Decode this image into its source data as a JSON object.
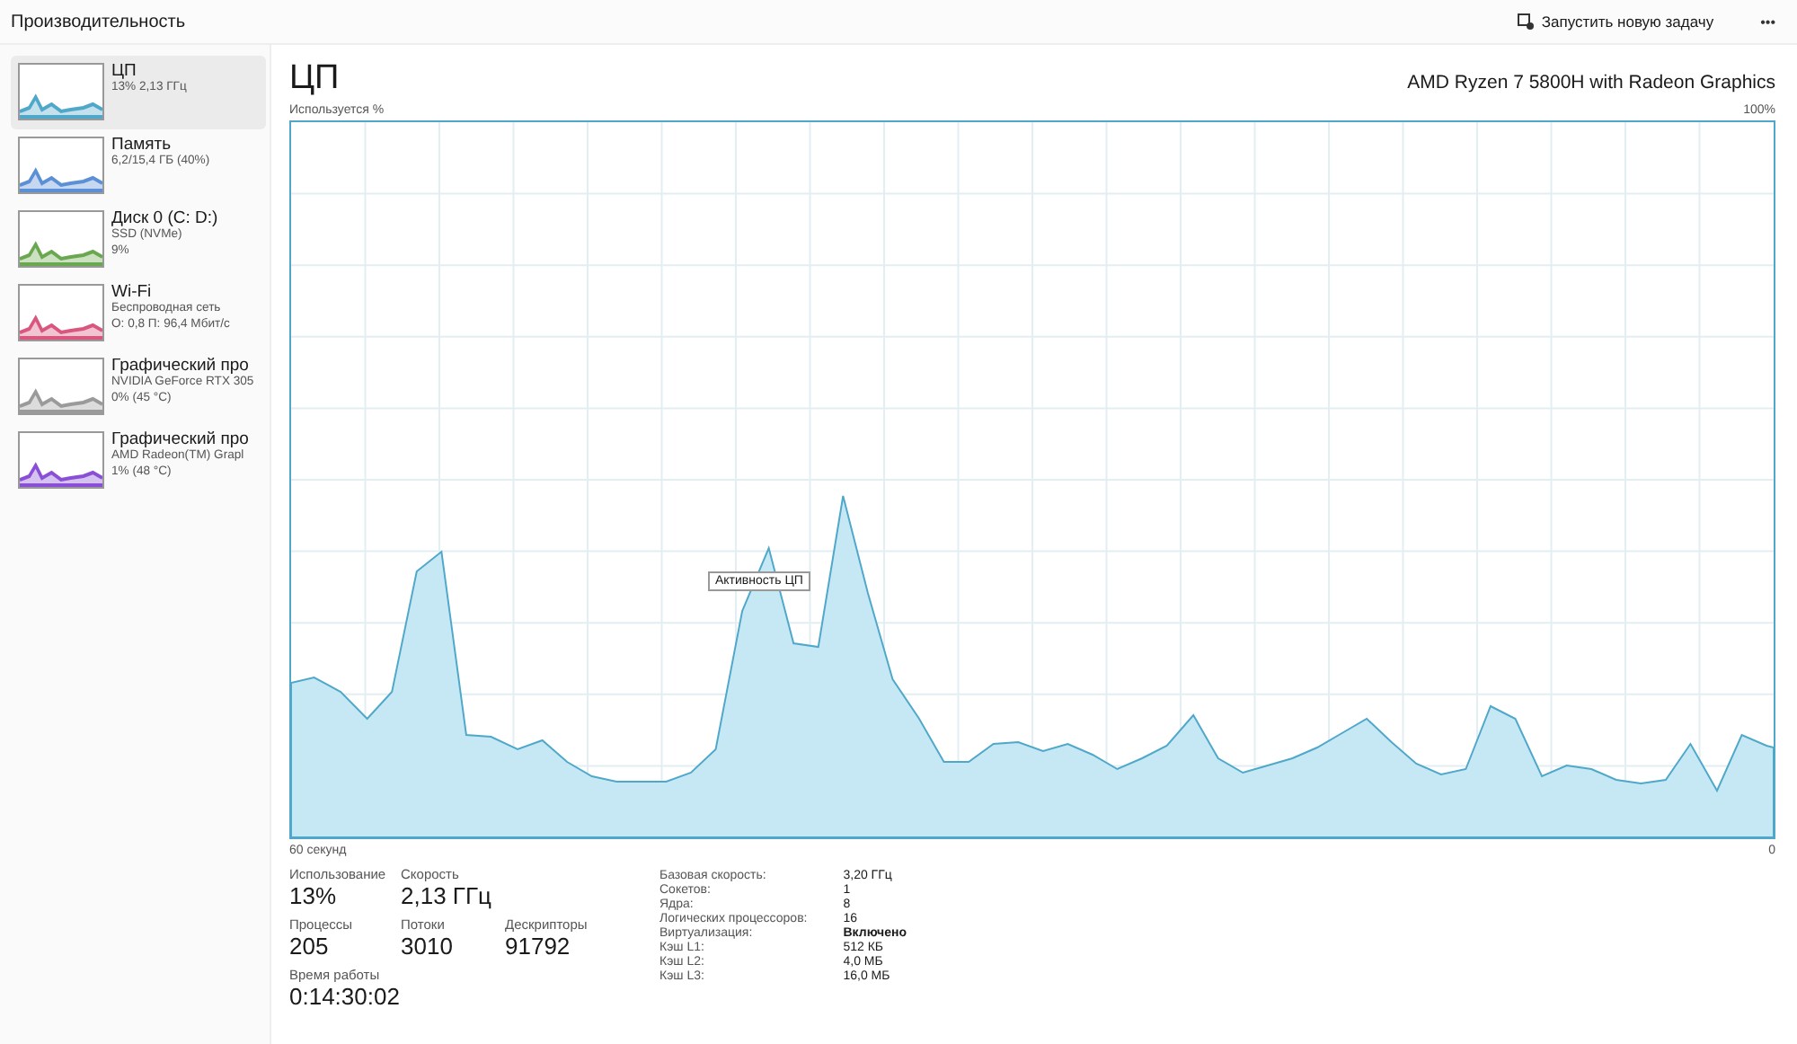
{
  "header": {
    "title": "Производительность",
    "new_task": "Запустить новую задачу",
    "more": "•••"
  },
  "sidebar": {
    "items": [
      {
        "name": "ЦП",
        "line1": "13% 2,13 ГГц",
        "selected": true,
        "color": "#4fa8c9"
      },
      {
        "name": "Память",
        "line1": "6,2/15,4 ГБ (40%)",
        "selected": false,
        "color": "#5b8fd6"
      },
      {
        "name": "Диск 0 (C: D:)",
        "line1": "SSD (NVMe)",
        "line2": "9%",
        "selected": false,
        "color": "#6aa84f"
      },
      {
        "name": "Wi-Fi",
        "line1": "Беспроводная сеть",
        "line2": "О: 0,8 П: 96,4 Мбит/с",
        "selected": false,
        "color": "#d9577f"
      },
      {
        "name": "Графический про",
        "line1": "NVIDIA GeForce RTX 305",
        "line2": "0% (45 °C)",
        "selected": false,
        "color": "#9a9a9a"
      },
      {
        "name": "Графический про",
        "line1": "AMD Radeon(TM) Grapl",
        "line2": "1% (48 °C)",
        "selected": false,
        "color": "#8a4fd6"
      }
    ]
  },
  "main": {
    "title": "ЦП",
    "model": "AMD Ryzen 7 5800H with Radeon Graphics",
    "y_label": "Используется %",
    "y_max": "100%",
    "x_label": "60 секунд",
    "x_min": "0",
    "tooltip": "Активность ЦП",
    "stats": [
      {
        "label": "Использование",
        "value": "13%"
      },
      {
        "label": "Скорость",
        "value": "2,13 ГГц"
      },
      {
        "label": "Процессы",
        "value": "205"
      },
      {
        "label": "Потоки",
        "value": "3010"
      },
      {
        "label": "Дескрипторы",
        "value": "91792"
      },
      {
        "label": "Время работы",
        "value": "0:14:30:02"
      }
    ],
    "details": [
      {
        "key": "Базовая скорость:",
        "value": "3,20 ГГц"
      },
      {
        "key": "Сокетов:",
        "value": "1"
      },
      {
        "key": "Ядра:",
        "value": "8"
      },
      {
        "key": "Логических процессоров:",
        "value": "16"
      },
      {
        "key": "Виртуализация:",
        "value": "Включено",
        "bold": true
      },
      {
        "key": "Кэш L1:",
        "value": "512 КБ"
      },
      {
        "key": "Кэш L2:",
        "value": "4,0 МБ"
      },
      {
        "key": "Кэш L3:",
        "value": "16,0 МБ"
      }
    ]
  }
}
